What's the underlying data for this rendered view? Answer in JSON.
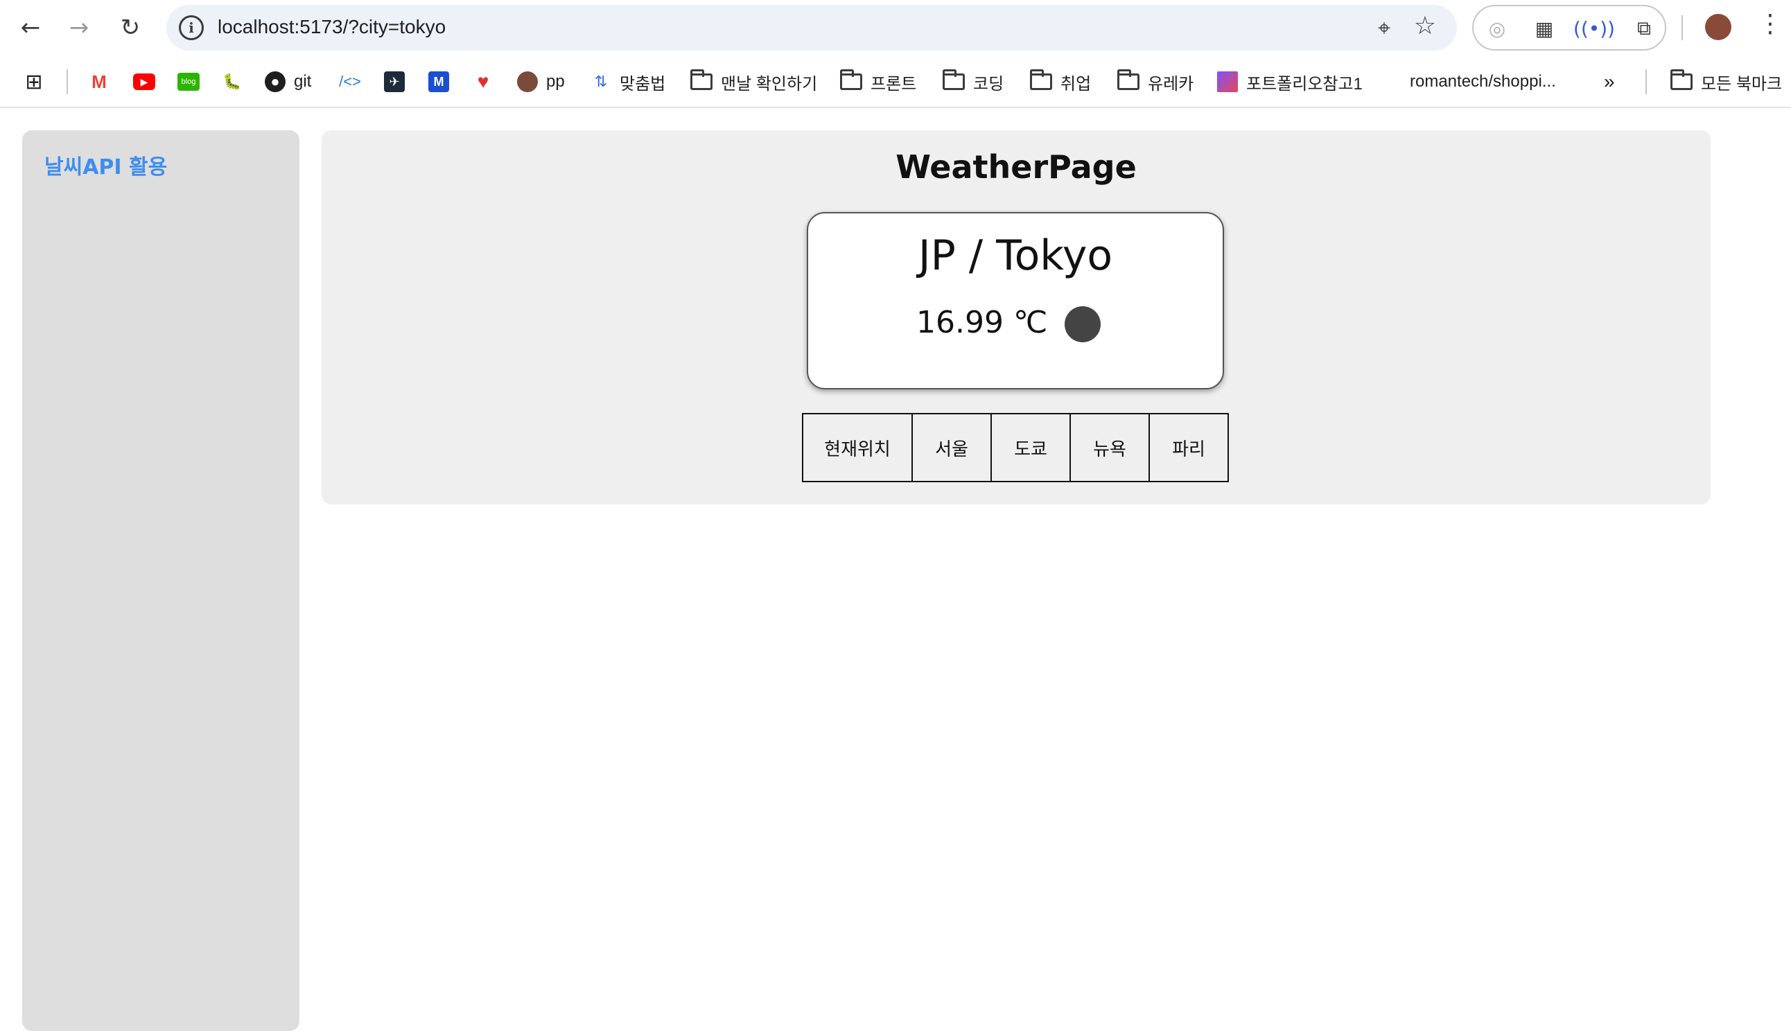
{
  "browser": {
    "url": "localhost:5173/?city=tokyo"
  },
  "bookmarks": [
    {
      "label": "",
      "icon": "apps-grid-icon"
    },
    {
      "label": "",
      "icon": "gmail-icon"
    },
    {
      "label": "",
      "icon": "youtube-icon"
    },
    {
      "label": "",
      "icon": "blog-icon"
    },
    {
      "label": "",
      "icon": "bug-icon"
    },
    {
      "label": "git",
      "icon": "github-icon"
    },
    {
      "label": "",
      "icon": "code-icon"
    },
    {
      "label": "",
      "icon": "bird-icon"
    },
    {
      "label": "",
      "icon": "m-icon"
    },
    {
      "label": "",
      "icon": "heart-icon"
    },
    {
      "label": "pp",
      "icon": "avatar-icon"
    },
    {
      "label": "맞춤법",
      "icon": "spell-icon"
    },
    {
      "label": "맨날 확인하기",
      "icon": "folder-icon"
    },
    {
      "label": "프론트",
      "icon": "folder-icon"
    },
    {
      "label": "코딩",
      "icon": "folder-icon"
    },
    {
      "label": "취업",
      "icon": "folder-icon"
    },
    {
      "label": "유레카",
      "icon": "folder-icon"
    },
    {
      "label": "포트폴리오참고1",
      "icon": "kotlin-icon"
    },
    {
      "label": "romantech/shoppi...",
      "icon": ""
    },
    {
      "label": "모든 북마크",
      "icon": "folder-icon"
    }
  ],
  "sidebar": {
    "title": "날씨API 활용"
  },
  "main": {
    "heading": "WeatherPage",
    "weather": {
      "location": "JP / Tokyo",
      "temperature": "16.99 ℃"
    },
    "city_buttons": [
      "현재위치",
      "서울",
      "도쿄",
      "뉴욕",
      "파리"
    ]
  }
}
